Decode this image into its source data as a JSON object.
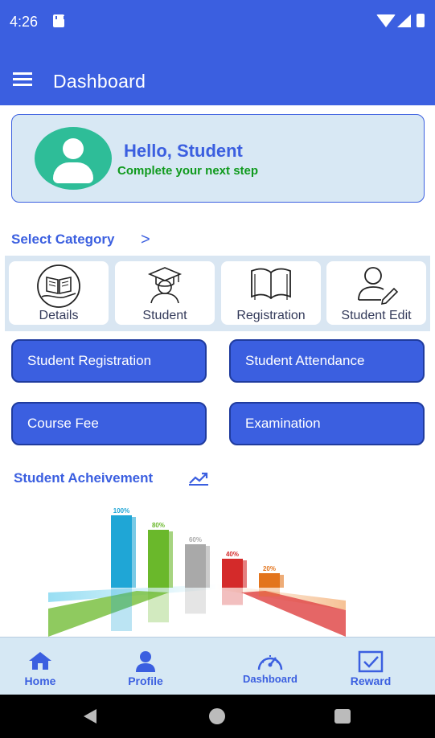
{
  "status_bar": {
    "time": "4:26"
  },
  "app_bar": {
    "title": "Dashboard"
  },
  "greeting": {
    "title": "Hello, Student",
    "subtitle": "Complete your next step"
  },
  "category": {
    "title": "Select Category",
    "chevron": ">",
    "items": [
      {
        "label": "Details",
        "icon": "book-hand-icon"
      },
      {
        "label": "Student",
        "icon": "graduate-icon"
      },
      {
        "label": "Registration",
        "icon": "open-book-icon"
      },
      {
        "label": "Student Edit",
        "icon": "user-edit-icon"
      }
    ]
  },
  "actions": [
    {
      "label": "Student Registration"
    },
    {
      "label": "Student Attendance"
    },
    {
      "label": "Course Fee"
    },
    {
      "label": "Examination"
    }
  ],
  "achievement": {
    "title": "Student Acheivement",
    "bars": [
      {
        "label": "100%",
        "value": 100,
        "color": "#1fa6d6"
      },
      {
        "label": "80%",
        "value": 80,
        "color": "#6ab82b"
      },
      {
        "label": "60%",
        "value": 60,
        "color": "#a9a9a9"
      },
      {
        "label": "40%",
        "value": 40,
        "color": "#d42a2a"
      },
      {
        "label": "20%",
        "value": 20,
        "color": "#e3741c"
      }
    ]
  },
  "bottom_nav": [
    {
      "label": "Home",
      "icon": "home-icon"
    },
    {
      "label": "Profile",
      "icon": "profile-icon"
    },
    {
      "label": "Dashboard",
      "icon": "speedometer-icon"
    },
    {
      "label": "Reward",
      "icon": "reward-icon"
    }
  ],
  "colors": {
    "primary": "#3b5fe0",
    "accent_green": "#0f9a1d",
    "avatar": "#2ebd98",
    "card_bg": "#d8e8f4"
  }
}
